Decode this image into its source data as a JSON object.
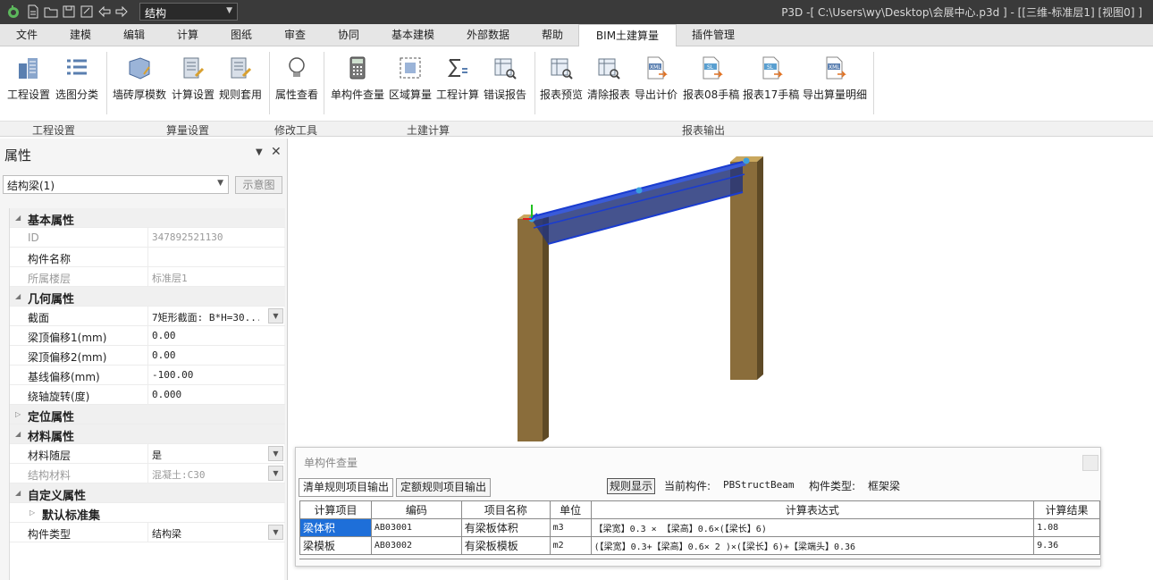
{
  "app": {
    "mode_select": "结构",
    "window_title": "P3D -[ C:\\Users\\wy\\Desktop\\会展中心.p3d ] - [[三维-标准层1] [视图0] ]"
  },
  "menu": {
    "tabs": [
      "文件",
      "建模",
      "编辑",
      "计算",
      "图纸",
      "审查",
      "协同",
      "基本建模",
      "外部数据",
      "帮助",
      "BIM土建算量",
      "插件管理"
    ],
    "active": "BIM土建算量"
  },
  "ribbon": {
    "buttons": [
      "工程设置",
      "选图分类",
      "墙砖厚模数",
      "计算设置",
      "规则套用",
      "属性查看",
      "单构件查量",
      "区域算量",
      "工程计算",
      "错误报告",
      "报表预览",
      "清除报表",
      "导出计价",
      "报表08手稿",
      "报表17手稿",
      "导出算量明细"
    ],
    "groups": [
      "工程设置",
      "算量设置",
      "修改工具",
      "土建计算",
      "报表输出"
    ]
  },
  "panel": {
    "title": "属性",
    "object_select": "结构梁(1)",
    "diagram_button": "示意图",
    "rows": [
      {
        "type": "cat",
        "label": "基本属性"
      },
      {
        "type": "ro",
        "label": "ID",
        "value": "347892521130"
      },
      {
        "type": "prop",
        "label": "构件名称",
        "value": ""
      },
      {
        "type": "ro",
        "label": "所属楼层",
        "value": "标准层1"
      },
      {
        "type": "cat",
        "label": "几何属性"
      },
      {
        "type": "prop",
        "label": "截面",
        "value": "7矩形截面: B*H=30...",
        "dropdown": true
      },
      {
        "type": "prop",
        "label": "梁顶偏移1(mm)",
        "value": "0.00"
      },
      {
        "type": "prop",
        "label": "梁顶偏移2(mm)",
        "value": "0.00"
      },
      {
        "type": "prop",
        "label": "基线偏移(mm)",
        "value": "-100.00"
      },
      {
        "type": "prop",
        "label": "绕轴旋转(度)",
        "value": "0.000"
      },
      {
        "type": "cat-collapsed",
        "label": "定位属性"
      },
      {
        "type": "cat",
        "label": "材料属性"
      },
      {
        "type": "prop",
        "label": "材料随层",
        "value": "是",
        "dropdown": true
      },
      {
        "type": "ro",
        "label": "结构材料",
        "value": "混凝土:C30",
        "dropdown": true
      },
      {
        "type": "cat",
        "label": "自定义属性"
      },
      {
        "type": "sub",
        "label": "默认标准集"
      },
      {
        "type": "prop",
        "label": "构件类型",
        "value": "结构梁",
        "dropdown": true
      }
    ]
  },
  "dialog": {
    "title": "单构件查量",
    "tabs": [
      "清单规则项目输出",
      "定额规则项目输出"
    ],
    "rule_button": "规则显示",
    "current_label": "当前构件:",
    "current_value": "PBStructBeam",
    "type_label": "构件类型:",
    "type_value": "框架梁",
    "columns": [
      "计算项目",
      "编码",
      "项目名称",
      "单位",
      "计算表达式",
      "计算结果"
    ],
    "rows": [
      [
        "梁体积",
        "AB03001",
        "有梁板体积",
        "m3",
        "【梁宽】0.3 × 【梁高】0.6×(【梁长】6)",
        "1.08"
      ],
      [
        "梁模板",
        "AB03002",
        "有梁板模板",
        "m2",
        "(【梁宽】0.3+【梁高】0.6× 2 )×(【梁长】6)+【梁端头】0.36",
        "9.36"
      ]
    ]
  },
  "colors": {
    "titlebar": "#3a3a3a",
    "column": "#8a6d3b",
    "beam": "#2a4fc0",
    "selection": "#1e6fd9"
  }
}
